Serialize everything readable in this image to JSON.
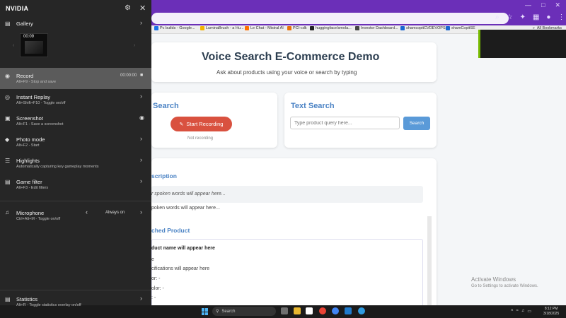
{
  "browser": {
    "bookmarks": [
      {
        "label": "Pc builds - Google...",
        "color": "#1a73e8"
      },
      {
        "label": "LuminaBrush - a Hu...",
        "color": "#f4b400"
      },
      {
        "label": "Le Chat - Mistral AI",
        "color": "#ff7000"
      },
      {
        "label": "PCI-cdk",
        "color": "#e8710a"
      },
      {
        "label": "huggingface/smola...",
        "color": "#222222"
      },
      {
        "label": "Investor Dashboard...",
        "color": "#444444"
      },
      {
        "label": "shamcopitCVDEVOPS",
        "color": "#1967d2"
      },
      {
        "label": "shamCopitSE",
        "color": "#1967d2"
      }
    ],
    "all_bookmarks": "All Bookmarks"
  },
  "page": {
    "title": "Voice Search E-Commerce Demo",
    "subtitle": "Ask about products using your voice or search by typing",
    "voice_heading": "Search",
    "start_button": "Start Recording",
    "recording_status": "Not recording",
    "text_heading": "Text Search",
    "search_placeholder": "Type product query here...",
    "search_button": "Search",
    "transcription_heading": "scription",
    "transcription_placeholder": "r spoken words will appear here...",
    "transcription_text": "poken words will appear here...",
    "matched_heading": "ched Product",
    "product_name": "duct name will appear here",
    "product_line1": "e",
    "product_line2": "cifications will appear here",
    "product_line3": "or: -",
    "product_line4": "olor: -",
    "product_line5": ": -"
  },
  "activate_windows": {
    "title": "Activate Windows",
    "subtitle": "Go to Settings to activate Windows."
  },
  "taskbar": {
    "search_label": "Search",
    "time": "8:12 PM",
    "date": "3/18/2025"
  },
  "nvidia": {
    "title": "NVIDIA",
    "gallery": {
      "label": "Gallery",
      "thumb_time": "00:09"
    },
    "record": {
      "label": "Record",
      "shortcut": "Alt+F9 - Stop and save",
      "timer": "00:00:00"
    },
    "instant_replay": {
      "label": "Instant Replay",
      "shortcut": "Alt+Shift+F10 - Toggle on/off"
    },
    "screenshot": {
      "label": "Screenshot",
      "shortcut": "Alt+F1 - Save a screenshot"
    },
    "photo_mode": {
      "label": "Photo mode",
      "shortcut": "Alt+F2 - Start"
    },
    "highlights": {
      "label": "Highlights",
      "shortcut": "Automatically capturing key gameplay moments"
    },
    "game_filter": {
      "label": "Game filter",
      "shortcut": "Alt+F3 - Edit filters"
    },
    "microphone": {
      "label": "Microphone",
      "shortcut": "Ctrl+Alt+M - Toggle on/off",
      "value": "Always on"
    },
    "statistics": {
      "label": "Statistics",
      "shortcut": "Alt+R - Toggle statistics overlay on/off"
    }
  },
  "colors": {
    "nvidia_green": "#76b900",
    "browser_purple": "#6b2fb8",
    "record_button": "#d9513f",
    "search_button": "#5a9ad8",
    "heading_blue": "#4a82c4"
  }
}
